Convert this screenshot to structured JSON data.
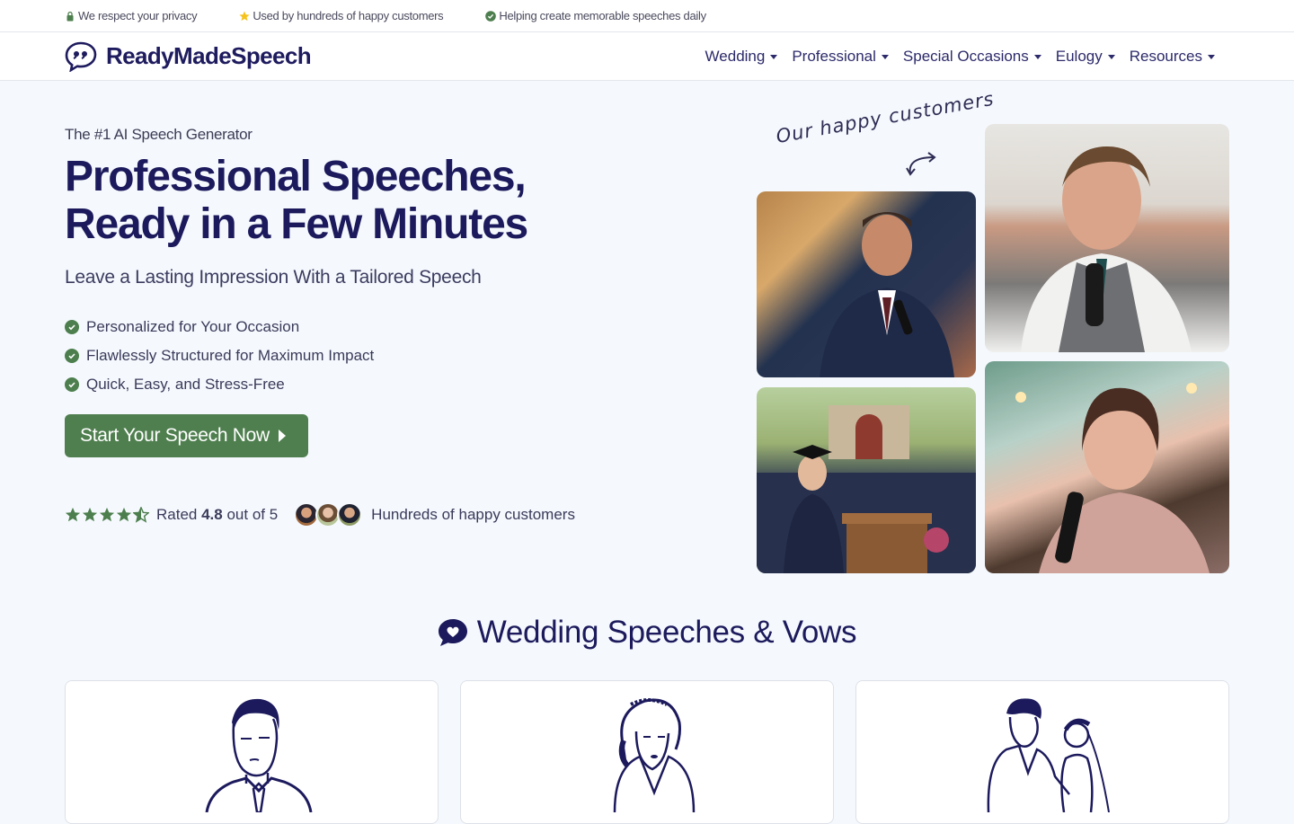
{
  "topbar": {
    "items": [
      {
        "icon": "lock-icon",
        "text": "We respect your privacy"
      },
      {
        "icon": "star-icon",
        "text": "Used by hundreds of happy customers"
      },
      {
        "icon": "check-circle-icon",
        "text": "Helping create memorable speeches daily"
      }
    ]
  },
  "brand": {
    "name": "ReadyMadeSpeech",
    "icon": "speech-bubble-quote-icon"
  },
  "nav": {
    "items": [
      {
        "label": "Wedding"
      },
      {
        "label": "Professional"
      },
      {
        "label": "Special Occasions"
      },
      {
        "label": "Eulogy"
      },
      {
        "label": "Resources"
      }
    ]
  },
  "hero": {
    "eyebrow": "The #1 AI Speech Generator",
    "title_line1": "Professional Speeches,",
    "title_line2": "Ready in a Few Minutes",
    "subtitle": "Leave a Lasting Impression With a Tailored Speech",
    "features": [
      "Personalized for Your Occasion",
      "Flawlessly Structured for Maximum Impact",
      "Quick, Easy, and Stress-Free"
    ],
    "cta_label": "Start Your Speech Now",
    "rating_prefix": "Rated ",
    "rating_value": "4.8",
    "rating_suffix": " out of 5",
    "rating_stars": 4.5,
    "customers_text": "Hundreds of happy customers",
    "handwritten_note": "Our happy customers",
    "photos": [
      {
        "alt": "Groom in navy suit giving speech with microphone"
      },
      {
        "alt": "Smiling man in grey vest holding microphone"
      },
      {
        "alt": "Graduate speaking at podium in front of crowd"
      },
      {
        "alt": "Smiling woman holding microphone at wedding"
      }
    ]
  },
  "section": {
    "title": "Wedding Speeches & Vows",
    "icon": "heart-speech-bubble-icon",
    "cards": [
      {
        "illustration": "groom-illustration"
      },
      {
        "illustration": "bride-illustration"
      },
      {
        "illustration": "couple-vows-illustration"
      }
    ]
  },
  "colors": {
    "brand_navy": "#1c1a5c",
    "accent_green": "#4f7f4f",
    "page_bg": "#f5f9fd",
    "star_gold": "#f6c21c"
  }
}
